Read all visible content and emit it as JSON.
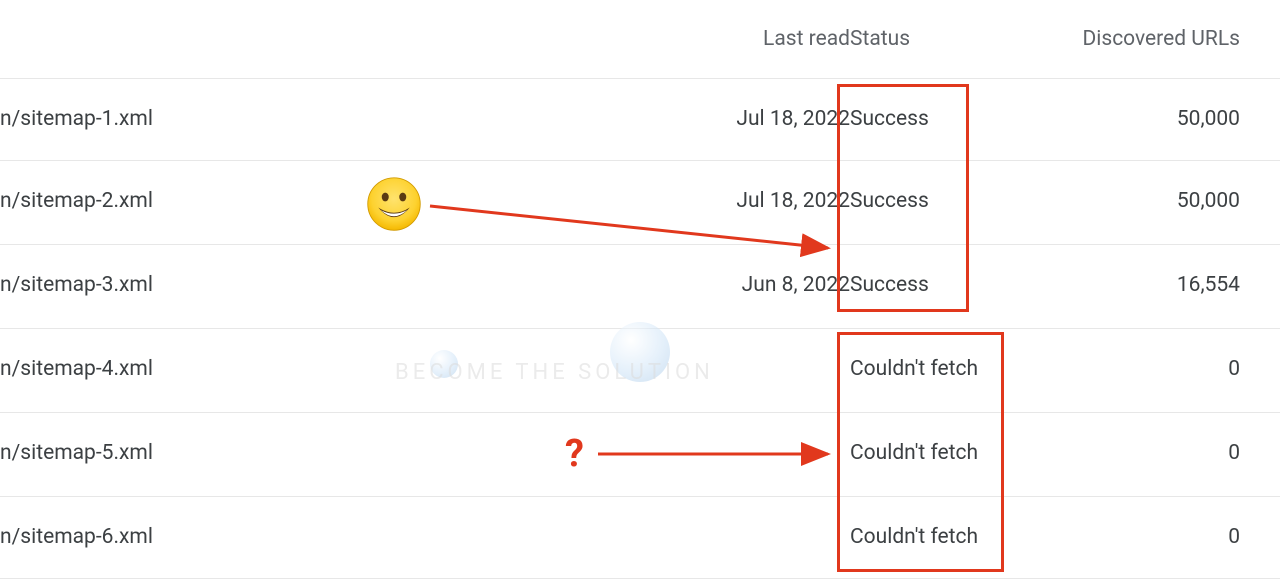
{
  "headers": {
    "last_read": "Last read",
    "status": "Status",
    "discovered_urls": "Discovered URLs"
  },
  "rows": [
    {
      "sitemap": "n/sitemap-1.xml",
      "last_read": "Jul 18, 2022",
      "status": "Success",
      "status_kind": "success",
      "urls": "50,000"
    },
    {
      "sitemap": "n/sitemap-2.xml",
      "last_read": "Jul 18, 2022",
      "status": "Success",
      "status_kind": "success",
      "urls": "50,000"
    },
    {
      "sitemap": "n/sitemap-3.xml",
      "last_read": "Jun 8, 2022",
      "status": "Success",
      "status_kind": "success",
      "urls": "16,554"
    },
    {
      "sitemap": "n/sitemap-4.xml",
      "last_read": "",
      "status": "Couldn't fetch",
      "status_kind": "error",
      "urls": "0"
    },
    {
      "sitemap": "n/sitemap-5.xml",
      "last_read": "",
      "status": "Couldn't fetch",
      "status_kind": "error",
      "urls": "0"
    },
    {
      "sitemap": "n/sitemap-6.xml",
      "last_read": "",
      "status": "Couldn't fetch",
      "status_kind": "error",
      "urls": "0"
    }
  ],
  "annotations": {
    "emoji_label": "smile-emoji",
    "question_mark": "?",
    "watermark_text": "BECOME THE SOLUTION"
  }
}
